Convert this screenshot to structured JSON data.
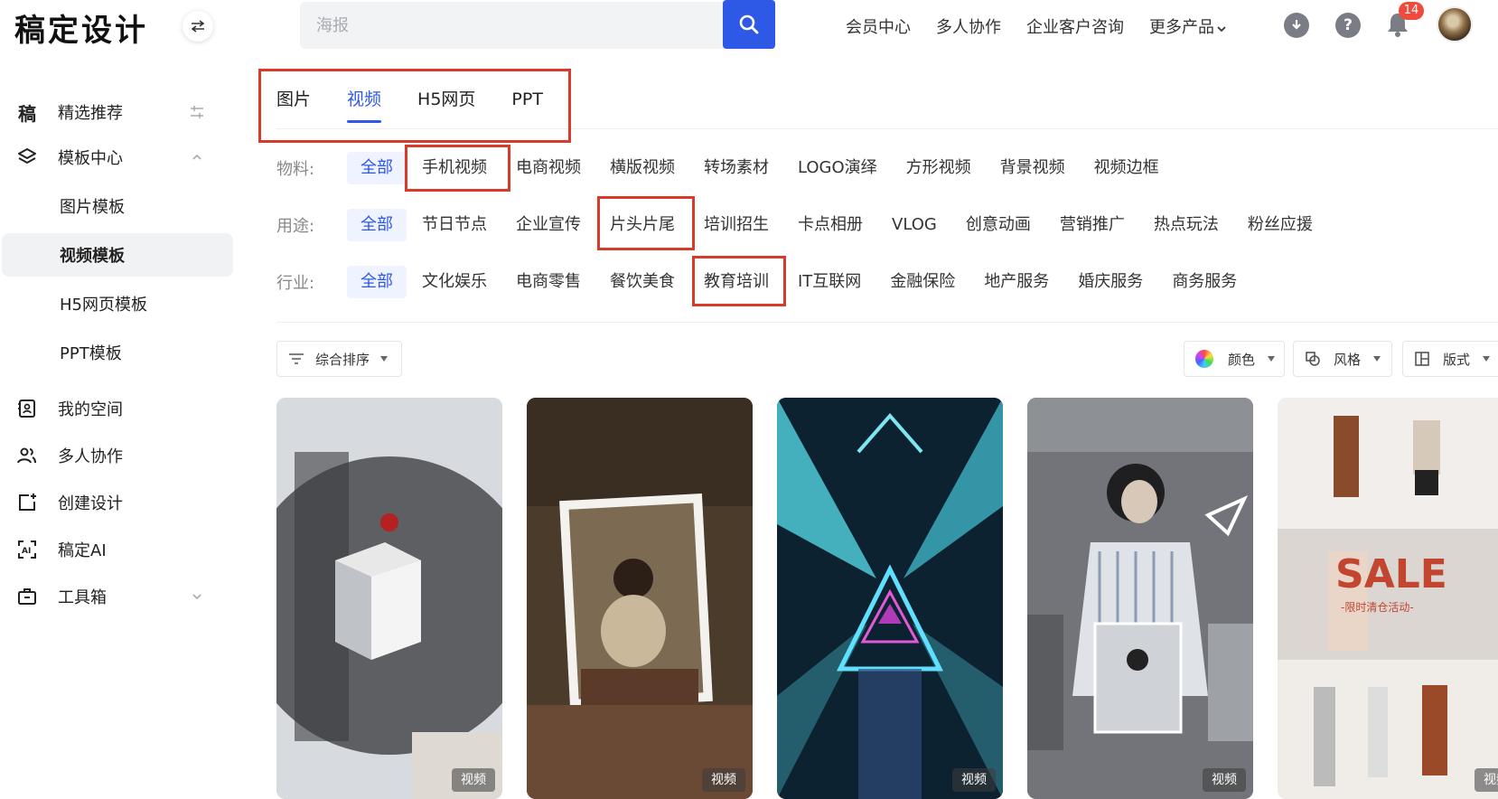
{
  "app": {
    "logo": "稿定设计"
  },
  "search": {
    "placeholder": "海报"
  },
  "topnav": [
    "会员中心",
    "多人协作",
    "企业客户咨询",
    "更多产品"
  ],
  "notifications": {
    "count": "14"
  },
  "sidebar": {
    "items": [
      {
        "label": "精选推荐",
        "icon": "gaoding-glyph-icon"
      },
      {
        "label": "模板中心",
        "icon": "layers-icon"
      }
    ],
    "sub_items": [
      "图片模板",
      "视频模板",
      "H5网页模板",
      "PPT模板"
    ],
    "active_sub": "视频模板",
    "bottom_items": [
      {
        "label": "我的空间",
        "icon": "person-folder-icon"
      },
      {
        "label": "多人协作",
        "icon": "users-icon"
      },
      {
        "label": "创建设计",
        "icon": "add-square-icon"
      },
      {
        "label": "稿定AI",
        "icon": "ai-icon"
      },
      {
        "label": "工具箱",
        "icon": "toolbox-icon"
      }
    ]
  },
  "tabs": [
    "图片",
    "视频",
    "H5网页",
    "PPT"
  ],
  "active_tab": "视频",
  "filters": {
    "material": {
      "label": "物料:",
      "options": [
        "全部",
        "手机视频",
        "电商视频",
        "横版视频",
        "转场素材",
        "LOGO演绎",
        "方形视频",
        "背景视频",
        "视频边框"
      ]
    },
    "usage": {
      "label": "用途:",
      "options": [
        "全部",
        "节日节点",
        "企业宣传",
        "片头片尾",
        "培训招生",
        "卡点相册",
        "VLOG",
        "创意动画",
        "营销推广",
        "热点玩法",
        "粉丝应援"
      ]
    },
    "industry": {
      "label": "行业:",
      "options": [
        "全部",
        "文化娱乐",
        "电商零售",
        "餐饮美食",
        "教育培训",
        "IT互联网",
        "金融保险",
        "地产服务",
        "婚庆服务",
        "商务服务"
      ]
    }
  },
  "sort": {
    "label": "综合排序"
  },
  "options": {
    "color": "颜色",
    "style": "风格",
    "layout": "版式"
  },
  "cards": [
    {
      "tag": "视频"
    },
    {
      "tag": "视频"
    },
    {
      "tag": "视频"
    },
    {
      "tag": "视频"
    },
    {
      "tag": "视频",
      "headline": "SALE",
      "subline": "-限时清仓活动-"
    }
  ],
  "colors": {
    "accent": "#2e59e6",
    "highlight": "#d93b2b",
    "badge": "#f04a3d"
  }
}
